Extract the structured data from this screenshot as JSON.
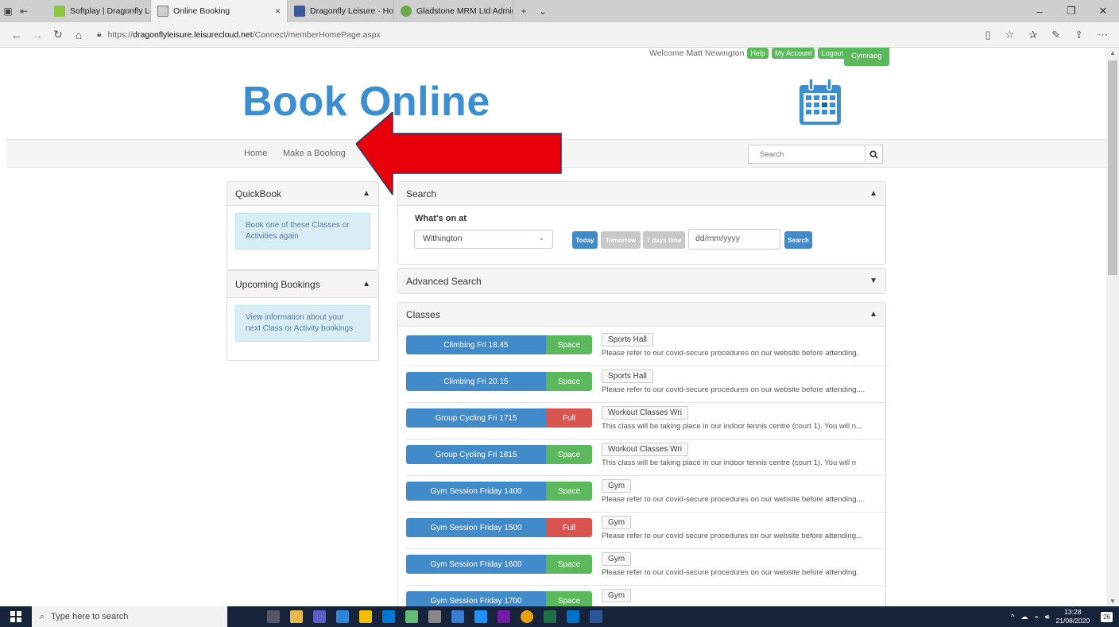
{
  "browser": {
    "tabs": [
      {
        "label": "Softplay | Dragonfly Leisure",
        "color": "#8dc63f"
      },
      {
        "label": "Online Booking",
        "color": "#cfcfcf",
        "active": true
      },
      {
        "label": "Dragonfly Leisure · Home",
        "color": "#3b5998"
      },
      {
        "label": "Gladstone MRM Ltd Admini",
        "color": "#6aa84f"
      }
    ],
    "url_prefix": "https://",
    "url_domain": "dragonflyleisure.leisurecloud.net",
    "url_path": "/Connect/memberHomePage.aspx"
  },
  "header": {
    "welcome": "Welcome Matt Newington",
    "help": "Help",
    "my_account": "My Account",
    "logout": "Logout",
    "language": "Cymraeg",
    "brand": "Book Online"
  },
  "nav": {
    "home": "Home",
    "make_booking": "Make a Booking",
    "search_placeholder": "Search"
  },
  "quickbook": {
    "title": "QuickBook",
    "info": "Book one of these Classes or Activities again"
  },
  "upcoming": {
    "title": "Upcoming Bookings",
    "info": "View information about your next Class or Activity bookings"
  },
  "search": {
    "title": "Search",
    "whats_on": "What's on at",
    "location": "Withington",
    "today": "Today",
    "tomorrow": "Tomorrow",
    "seven_days": "7 days time",
    "date_placeholder": "dd/mm/yyyy",
    "search_btn": "Search"
  },
  "advanced": {
    "title": "Advanced Search"
  },
  "classes": {
    "title": "Classes",
    "rows": [
      {
        "name": "Climbing Fri 18.45",
        "status": "Space",
        "venue": "Sports Hall",
        "desc": "Please refer to our covid-secure procedures on our website before attending."
      },
      {
        "name": "Climbing Fri 20.15",
        "status": "Space",
        "venue": "Sports Hall",
        "desc": "Please refer to our covid-secure procedures on our website before attending...."
      },
      {
        "name": "Group Cycling Fri 1715",
        "status": "Full",
        "venue": "Workout Classes Wri",
        "desc": "This class will be taking place in our indoor tennis centre (court 1). You will n..."
      },
      {
        "name": "Group Cycling Fri 1815",
        "status": "Space",
        "venue": "Workout Classes Wri",
        "desc": "This class will be taking place in our indoor tennis centre (court 1). You will n"
      },
      {
        "name": "Gym Session Friday 1400",
        "status": "Space",
        "venue": "Gym",
        "desc": "Please refer to our covid-secure procedures on our website before attending...."
      },
      {
        "name": "Gym Session Friday 1500",
        "status": "Full",
        "venue": "Gym",
        "desc": "Please refer to our covid secure procedures on our website before attending..."
      },
      {
        "name": "Gym Session Friday 1600",
        "status": "Space",
        "venue": "Gym",
        "desc": "Please refer to our covid-secure procedures on our website before attending."
      },
      {
        "name": "Gym Session Friday 1700",
        "status": "Space",
        "venue": "Gym",
        "desc": ""
      }
    ]
  },
  "taskbar": {
    "search_placeholder": "Type here to search",
    "time": "13:28",
    "date": "21/08/2020",
    "notif_count": "26"
  },
  "colors": {
    "brand": "#3b8ed0",
    "primary": "#428bca",
    "success": "#5cb85c",
    "danger": "#d9534f",
    "annotation_arrow": "#e8000b"
  }
}
